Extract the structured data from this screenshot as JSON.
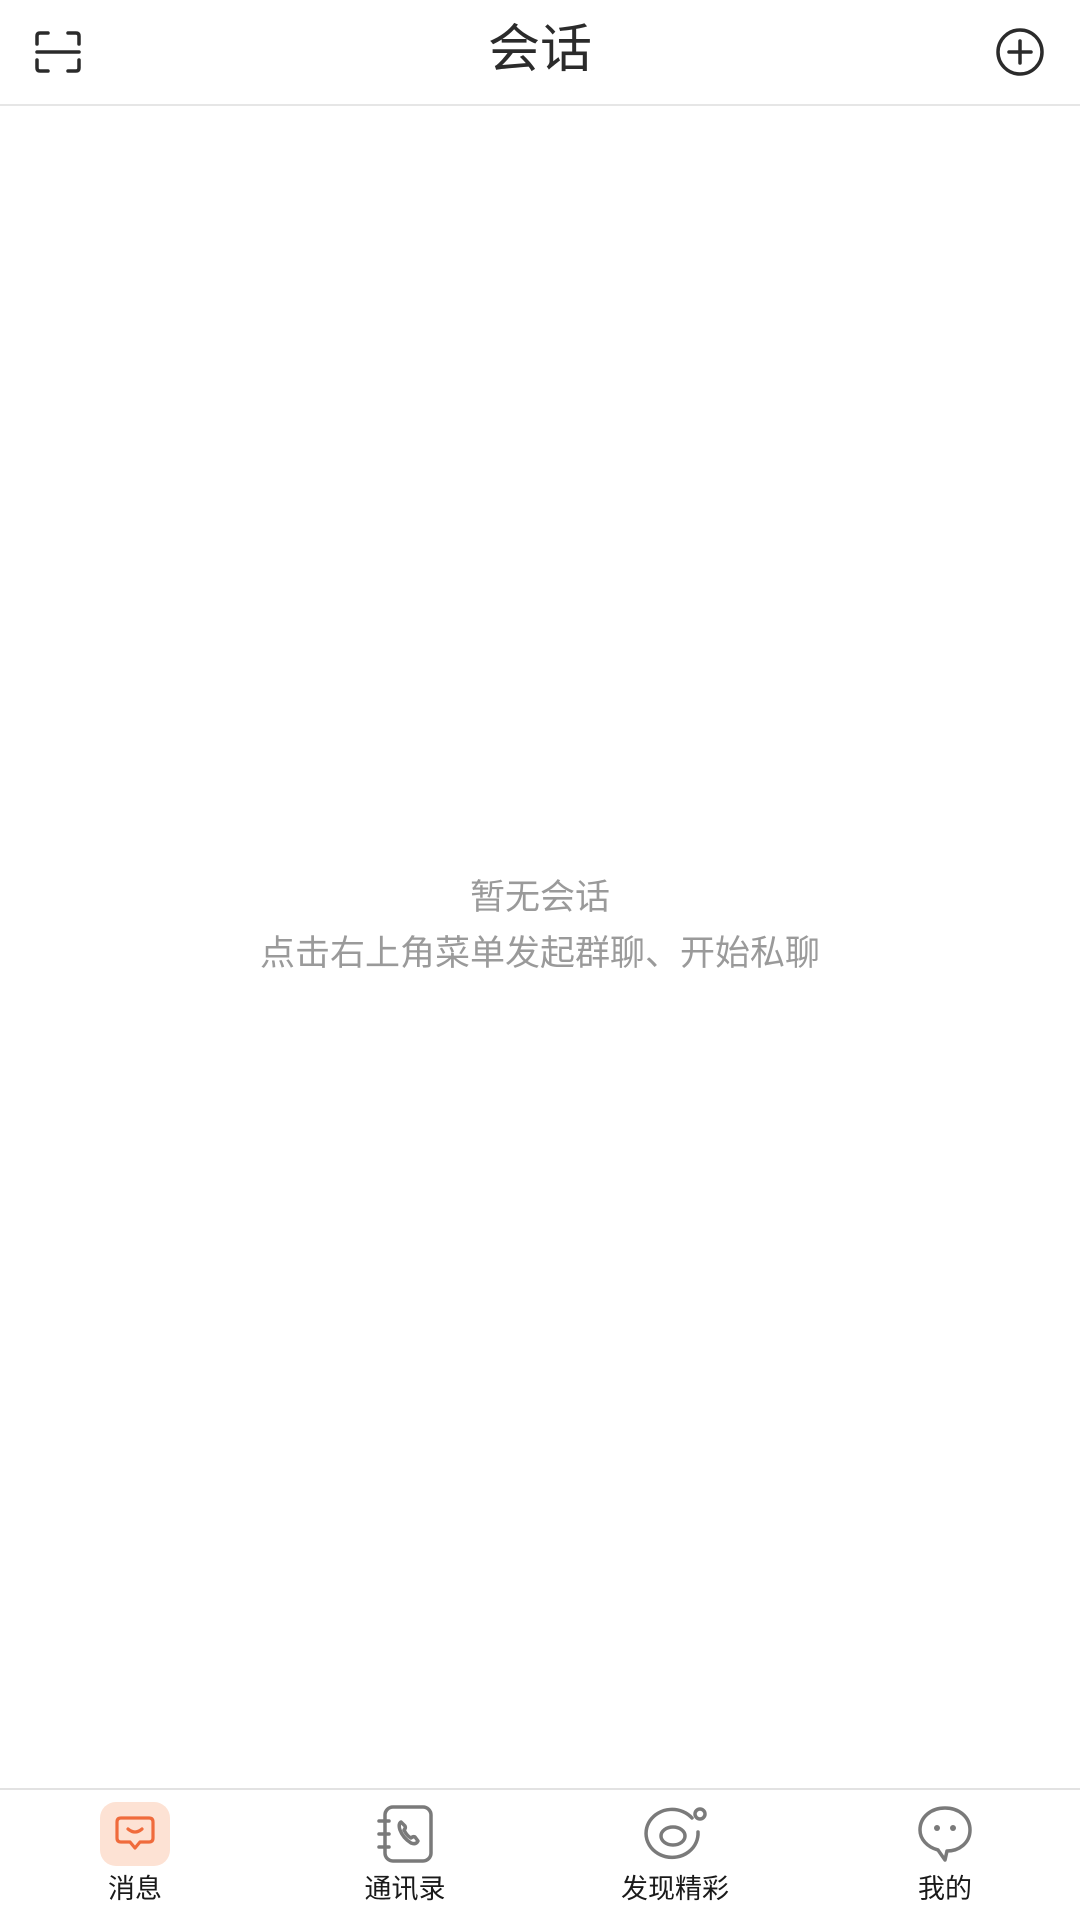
{
  "header": {
    "title": "会话",
    "scan_icon": "scan-icon",
    "add_icon": "plus-circle-icon"
  },
  "empty_state": {
    "title": "暂无会话",
    "hint": "点击右上角菜单发起群聊、开始私聊"
  },
  "tabbar": {
    "active_color": "#f06b3c",
    "active_bg": "#fde2d4",
    "inactive_color": "#7a7a7a",
    "tabs": [
      {
        "label": "消息",
        "icon": "chat-bubble-icon",
        "active": true
      },
      {
        "label": "通讯录",
        "icon": "contacts-book-icon",
        "active": false
      },
      {
        "label": "发现精彩",
        "icon": "discover-planet-icon",
        "active": false
      },
      {
        "label": "我的",
        "icon": "profile-face-icon",
        "active": false
      }
    ]
  }
}
